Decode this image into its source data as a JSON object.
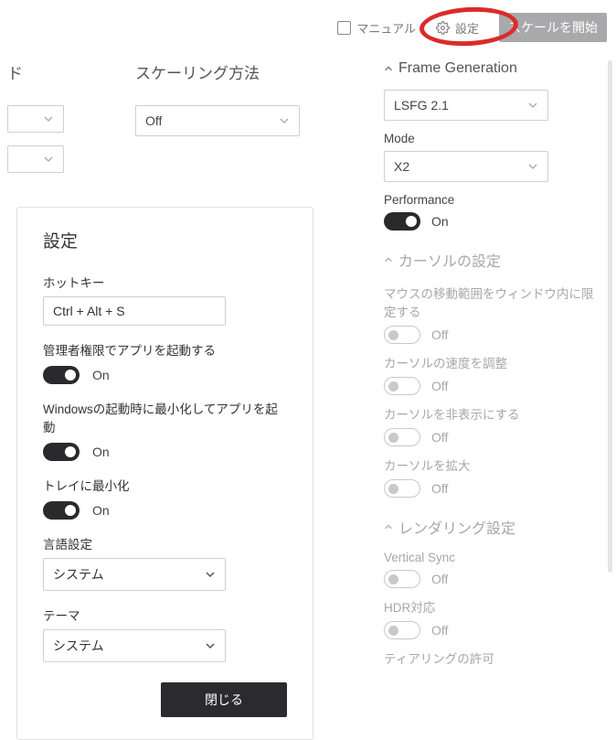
{
  "topbar": {
    "manual_label": "マニュアル",
    "settings_label": "設定",
    "start_label": "スケールを開始"
  },
  "col1": {
    "title": "ド"
  },
  "col2": {
    "title": "スケーリング方法",
    "select_value": "Off"
  },
  "frame_gen": {
    "title": "Frame Generation",
    "algo_value": "LSFG 2.1",
    "mode_label": "Mode",
    "mode_value": "X2",
    "perf_label": "Performance",
    "perf_state": "On"
  },
  "cursor": {
    "title": "カーソルの設定",
    "confine_label": "マウスの移動範囲をウィンドウ内に限定する",
    "confine_state": "Off",
    "speed_label": "カーソルの速度を調整",
    "speed_state": "Off",
    "hide_label": "カーソルを非表示にする",
    "hide_state": "Off",
    "scale_label": "カーソルを拡大",
    "scale_state": "Off"
  },
  "rendering": {
    "title": "レンダリング設定",
    "vsync_label": "Vertical Sync",
    "vsync_state": "Off",
    "hdr_label": "HDR対応",
    "hdr_state": "Off",
    "tearing_label": "ティアリングの許可"
  },
  "dialog": {
    "title": "設定",
    "hotkey_label": "ホットキー",
    "hotkey_value": "Ctrl + Alt + S",
    "admin_label": "管理者権限でアプリを起動する",
    "admin_state": "On",
    "startup_label": "Windowsの起動時に最小化してアプリを起動",
    "startup_state": "On",
    "tray_label": "トレイに最小化",
    "tray_state": "On",
    "lang_label": "言語設定",
    "lang_value": "システム",
    "theme_label": "テーマ",
    "theme_value": "システム",
    "close_label": "閉じる"
  }
}
